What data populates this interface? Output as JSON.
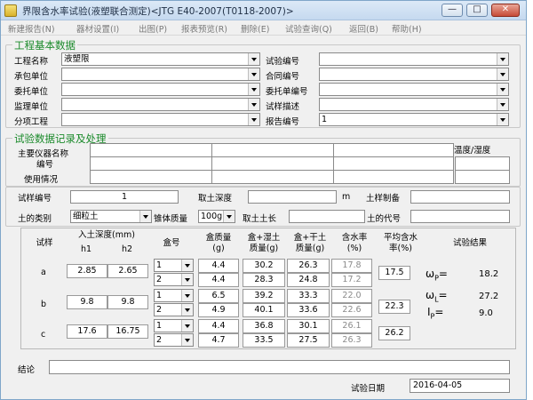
{
  "window": {
    "title": "界限含水率试验(液塑联合测定)<JTG E40-2007(T0118-2007)>",
    "buttons": {
      "minimize": "—",
      "maximize": "□",
      "close": "✕"
    }
  },
  "menu": [
    "新建报告(N)",
    "器材设置(I)",
    "出图(P)",
    "报表预览(R)",
    "删除(E)",
    "试验查询(Q)",
    "返回(B)",
    "帮助(H)"
  ],
  "basic": {
    "title": "工程基本数据",
    "project_name_label": "工程名称",
    "project_name_value": "液塑限",
    "contractor_label": "承包单位",
    "client_label": "委托单位",
    "supervisor_label": "监理单位",
    "subitem_label": "分项工程",
    "test_no_label": "试验编号",
    "contract_no_label": "合同编号",
    "entrust_no_label": "委托单编号",
    "sample_desc_label": "试样描述",
    "report_no_label": "报告编号",
    "report_no_value": "1"
  },
  "record": {
    "title": "试验数据记录及处理",
    "instrument_label1": "主要仪器名称",
    "instrument_label2": "编号",
    "usage_label": "使用情况",
    "temp_label": "温度/湿度"
  },
  "test": {
    "test_no_label": "试样编号",
    "test_no_value": "1",
    "depth_label": "取土深度",
    "depth_unit": "m",
    "preparation_label": "土样制备",
    "soil_type_label": "土的类别",
    "soil_type_value": "细粒土",
    "cone_mass_label": "锥体质量",
    "cone_mass_value": "100g",
    "chainage_label": "取土土长",
    "soil_code_label": "土的代号"
  },
  "table": {
    "h_sample": "试样",
    "h_depth": "入土深度(mm)",
    "h_h1": "h1",
    "h_h2": "h2",
    "h_box": "盒号",
    "h_box_mass1": "盒质量",
    "h_box_mass2": "(g)",
    "h_wet1": "盒+湿土",
    "h_wet2": "质量(g)",
    "h_dry1": "盒+干土",
    "h_dry2": "质量(g)",
    "h_moist1": "含水率",
    "h_moist2": "(%)",
    "h_avg1": "平均含水",
    "h_avg2": "率(%)",
    "h_result": "试验结果",
    "rows": [
      {
        "name": "a",
        "h1": "2.85",
        "h2": "2.65",
        "avg": "17.5",
        "boxes": [
          {
            "no": "1",
            "mass": "4.4",
            "wet": "30.2",
            "dry": "26.3",
            "w": "17.8"
          },
          {
            "no": "2",
            "mass": "4.4",
            "wet": "28.3",
            "dry": "24.8",
            "w": "17.2"
          }
        ]
      },
      {
        "name": "b",
        "h1": "9.8",
        "h2": "9.8",
        "avg": "22.3",
        "boxes": [
          {
            "no": "1",
            "mass": "6.5",
            "wet": "39.2",
            "dry": "33.3",
            "w": "22.0"
          },
          {
            "no": "2",
            "mass": "4.9",
            "wet": "40.1",
            "dry": "33.6",
            "w": "22.6"
          }
        ]
      },
      {
        "name": "c",
        "h1": "17.6",
        "h2": "16.75",
        "avg": "26.2",
        "boxes": [
          {
            "no": "1",
            "mass": "4.4",
            "wet": "36.8",
            "dry": "30.1",
            "w": "26.1"
          },
          {
            "no": "2",
            "mass": "4.7",
            "wet": "33.5",
            "dry": "27.5",
            "w": "26.3"
          }
        ]
      }
    ],
    "results": [
      {
        "sym": "ω",
        "sub": "P",
        "value": "18.2"
      },
      {
        "sym": "ω",
        "sub": "L",
        "value": "27.2"
      },
      {
        "sym": "I",
        "sub": "P",
        "value": "9.0"
      }
    ]
  },
  "footer": {
    "conclusion_label": "结论",
    "date_label": "试验日期",
    "date_value": "2016-04-05"
  }
}
